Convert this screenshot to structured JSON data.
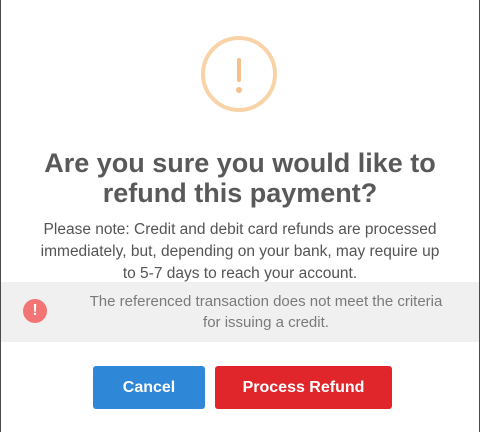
{
  "dialog": {
    "icon": "exclamation-warning-icon",
    "title_line1": "Are you sure you would like to",
    "title_line2": "refund this payment?",
    "note_line1": "Please note: Credit and debit card refunds are processed",
    "note_line2": "immediately, but, depending on your bank, may require up",
    "note_line3": "to 5-7 days to reach your account.",
    "error": {
      "icon": "error-circle-icon",
      "icon_glyph": "!",
      "line1": "The referenced transaction does not meet the criteria",
      "line2": "for issuing a credit."
    },
    "buttons": {
      "cancel_label": "Cancel",
      "confirm_label": "Process Refund"
    },
    "colors": {
      "warning_ring": "#f8d3a8",
      "error_icon": "#f27474",
      "cancel_button": "#2f87d8",
      "confirm_button": "#e0262b"
    }
  }
}
